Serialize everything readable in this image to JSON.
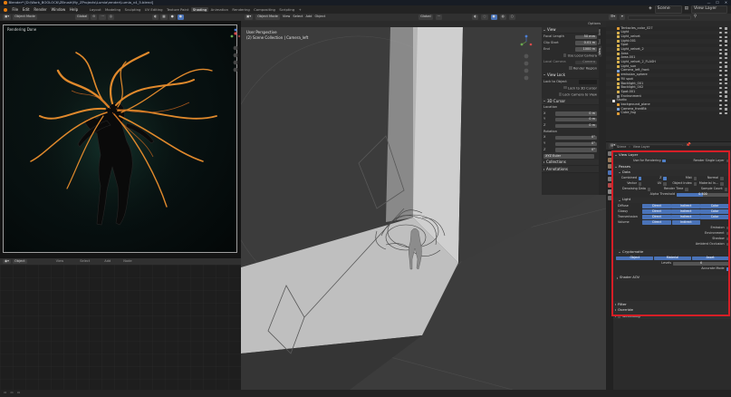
{
  "window": {
    "title": "Blender* [D:\\Work_BOOLOCK\\ZBrush\\My_ZProjects\\Lumia\\render\\Lumia_v4_5.blend]"
  },
  "menu": [
    "File",
    "Edit",
    "Render",
    "Window",
    "Help"
  ],
  "workspaces": [
    {
      "label": "Layout",
      "active": false
    },
    {
      "label": "Modeling",
      "active": false
    },
    {
      "label": "Sculpting",
      "active": false
    },
    {
      "label": "UV Editing",
      "active": false
    },
    {
      "label": "Texture Paint",
      "active": false
    },
    {
      "label": "Shading",
      "active": true
    },
    {
      "label": "Animation",
      "active": false
    },
    {
      "label": "Rendering",
      "active": false
    },
    {
      "label": "Compositing",
      "active": false
    },
    {
      "label": "Scripting",
      "active": false
    }
  ],
  "topright": {
    "scene": "Scene",
    "view_layer": "View Layer"
  },
  "render_view": {
    "mode": "Object Mode",
    "status": "Rendering Done",
    "orientation": "Global"
  },
  "node_editor": {
    "mode": "Object",
    "view": "View",
    "select": "Select",
    "add": "Add",
    "node": "Node"
  },
  "viewport": {
    "mode": "Object Mode",
    "menus": [
      "View",
      "Select",
      "Add",
      "Object"
    ],
    "orientation": "Global",
    "options": "Options",
    "info_line1": "User Perspective",
    "info_line2": "(2) Scene Collection | Camera_left"
  },
  "n_panel": {
    "view_header": "View",
    "focal_length_label": "Focal Length",
    "focal_length": "50 mm",
    "clip_start_label": "Clip Start",
    "clip_start": "0.01 m",
    "end_label": "End",
    "end": "1000 m",
    "use_local_camera": "Use Local Camera",
    "local_camera_label": "Local Camera",
    "local_camera": "Camera",
    "render_region": "Render Region",
    "view_lock": "View Lock",
    "lock_to_object": "Lock to Object",
    "lock_to_3d_cursor": "Lock to 3D Cursor",
    "lock_camera_to_view": "Lock Camera to View",
    "cursor_header": "3D Cursor",
    "location": "Location",
    "loc": [
      {
        "axis": "X",
        "value": "0 m"
      },
      {
        "axis": "Y",
        "value": "0 m"
      },
      {
        "axis": "Z",
        "value": "0 m"
      }
    ],
    "rotation": "Rotation",
    "rot": [
      {
        "axis": "X",
        "value": "0°"
      },
      {
        "axis": "Y",
        "value": "0°"
      },
      {
        "axis": "Z",
        "value": "0°"
      }
    ],
    "rotation_mode": "XYZ Euler",
    "collections": "Collections",
    "annotations": "Annotations",
    "tabs": [
      "Item",
      "Tool",
      "View"
    ]
  },
  "outliner": {
    "items": [
      {
        "name": "Tentacles_color_027",
        "color": "#e09c35"
      },
      {
        "name": "Light",
        "color": "#d8b24f"
      },
      {
        "name": "Light_velvet",
        "color": "#d8b24f"
      },
      {
        "name": "Light.001",
        "color": "#d8b24f"
      },
      {
        "name": "Spot",
        "color": "#d8b24f"
      },
      {
        "name": "Light_velvet_2",
        "color": "#d8b24f"
      },
      {
        "name": "Area",
        "color": "#d8b24f"
      },
      {
        "name": "Area.001",
        "color": "#d8b24f"
      },
      {
        "name": "Light_velvet_2_FLASH",
        "color": "#d8b24f"
      },
      {
        "name": "Light_sun",
        "color": "#d8b24f"
      },
      {
        "name": "Camera_left_front",
        "color": "#7da3d8"
      },
      {
        "name": "emission_sphere",
        "color": "#e09c35"
      },
      {
        "name": "Fill spot",
        "color": "#d8b24f"
      },
      {
        "name": "Backlight_001",
        "color": "#d8b24f"
      },
      {
        "name": "Backlight_002",
        "color": "#d8b24f"
      },
      {
        "name": "Spot.001",
        "color": "#d8b24f"
      },
      {
        "name": "Environment",
        "color": "#8f8f8f"
      },
      {
        "name": "Studio",
        "color": "#e0e0e0"
      },
      {
        "name": "background_plane",
        "color": "#e09c35"
      },
      {
        "name": "Camera_frontBk",
        "color": "#7da3d8"
      },
      {
        "name": "Cube_fog",
        "color": "#e09c35"
      }
    ]
  },
  "properties": {
    "header_scene": "Scene",
    "header_view_layer": "View Layer",
    "view_layer_section": "View Layer",
    "use_for_rendering": "Use for Rendering",
    "render_single_layer": "Render Single Layer",
    "passes": "Passes",
    "data": "Data",
    "combined": "Combined",
    "z": "Z",
    "mist": "Mist",
    "normal": "Normal",
    "vector": "Vector",
    "uv": "UV",
    "object_index": "Object Index",
    "material_index": "Material In...",
    "denoising_data": "Denoising Data",
    "render_time": "Render Time",
    "sample_count": "Sample Count",
    "alpha_threshold_label": "Alpha Threshold",
    "alpha_threshold": "0.500",
    "light": "Light",
    "diffuse": "Diffuse",
    "glossy": "Glossy",
    "transmission": "Transmission",
    "volume": "Volume",
    "direct": "Direct",
    "indirect": "Indirect",
    "color": "Color",
    "emission": "Emission",
    "environment": "Environment",
    "shadow": "Shadow",
    "ambient_occlusion": "Ambient Occlusion",
    "cryptomatte": "Cryptomatte",
    "crypto_object": "Object",
    "crypto_material": "Material",
    "crypto_asset": "Asset",
    "levels_label": "Levels",
    "levels": "6",
    "accurate_mode": "Accurate Mode",
    "shader_aov": "Shader AOV",
    "filter": "Filter",
    "override": "Override",
    "denoising": "Denoising"
  },
  "colors": {
    "accent": "#4a73b8",
    "highlight": "#d61e26",
    "orange_object": "#e0892c"
  }
}
